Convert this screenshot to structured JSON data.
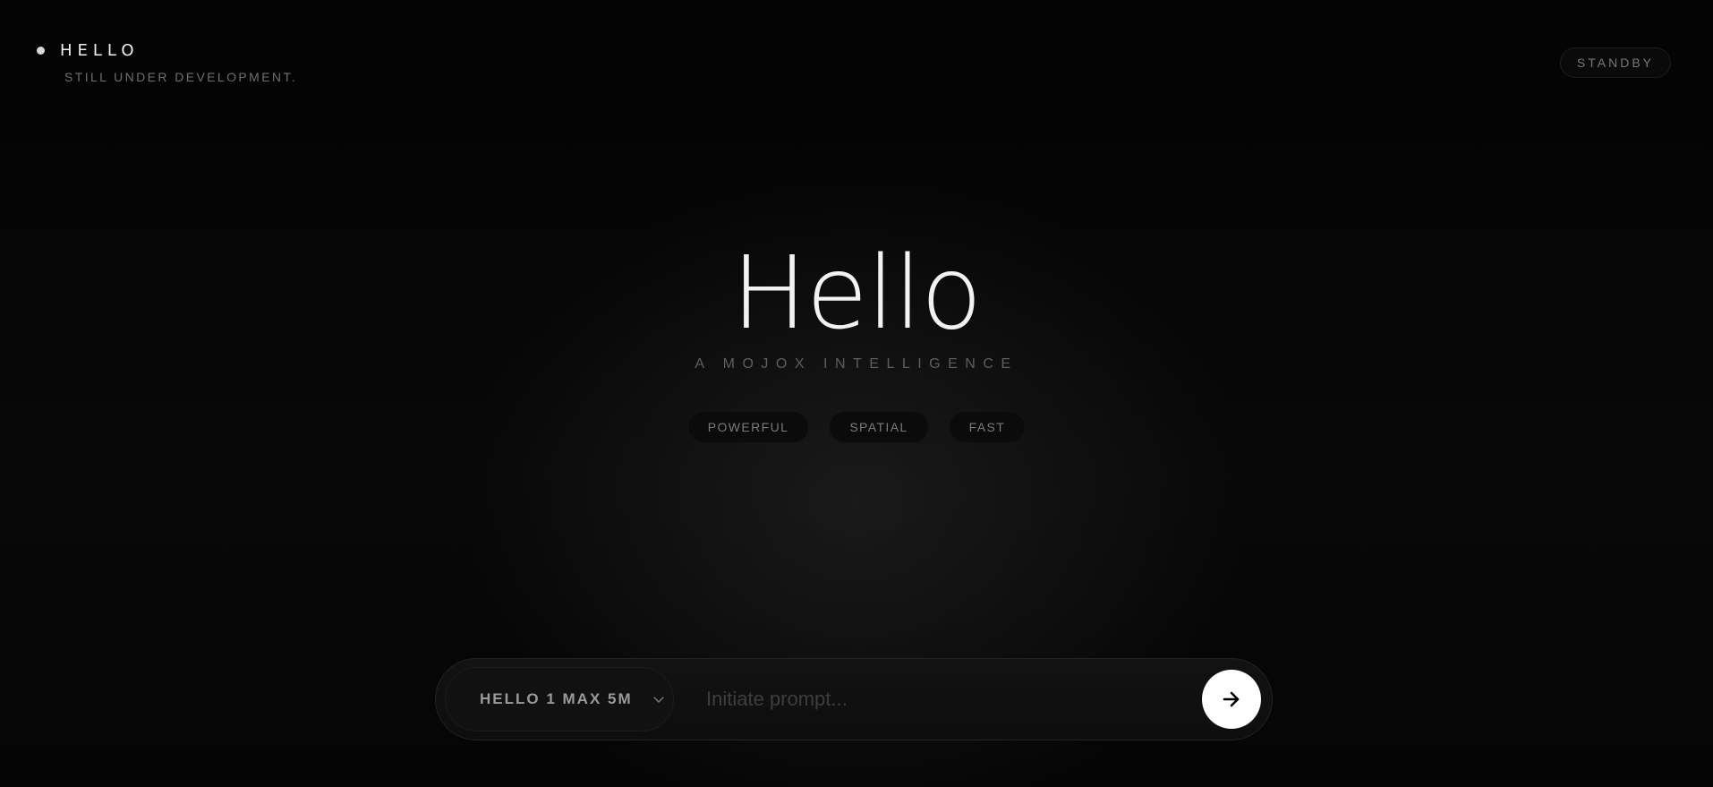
{
  "brand": {
    "title": "HELLO",
    "subtitle": "STILL UNDER DEVELOPMENT."
  },
  "status": {
    "label": "STANDBY"
  },
  "hero": {
    "title": "Hello",
    "subtitle": "A MOJOX INTELLIGENCE"
  },
  "tags": [
    "POWERFUL",
    "SPATIAL",
    "FAST"
  ],
  "composer": {
    "model": "HELLO 1 MAX 5M",
    "placeholder": "Initiate prompt...",
    "value": ""
  },
  "icons": {
    "status_dot": "dot-icon",
    "model_dropdown": "chevron-down-icon",
    "send": "arrow-right-icon"
  },
  "colors": {
    "background": "#050505",
    "send_button": "#ffffff",
    "text_primary": "#f2f2f2",
    "text_muted": "#6f6f6f"
  }
}
